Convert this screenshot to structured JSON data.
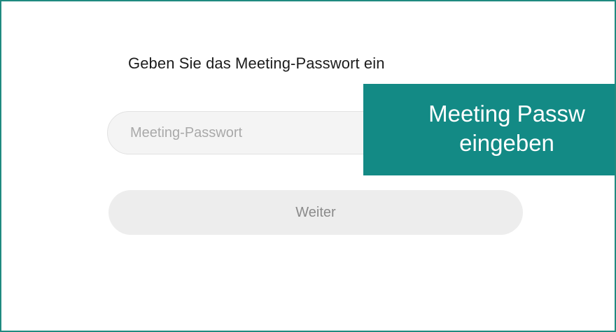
{
  "dialog": {
    "title": "Geben Sie das Meeting-Passwort ein",
    "password_placeholder": "Meeting-Passwort",
    "password_value": "",
    "next_label": "Weiter"
  },
  "callout": {
    "line1": "Meeting Passw",
    "line2": "eingeben"
  },
  "colors": {
    "frame_border": "#1f8a80",
    "callout_background": "#138a85",
    "button_background": "#ededed"
  }
}
